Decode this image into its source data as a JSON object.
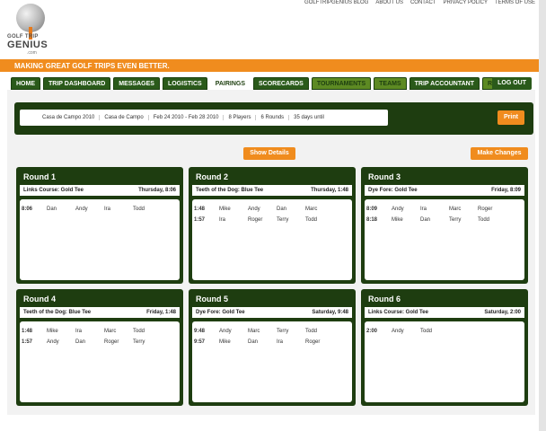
{
  "logo": {
    "line1": "GOLF TRIP",
    "line2": "GENIUS",
    "line3": ".com"
  },
  "top_links": [
    "GOLFTRIPGENIUS BLOG",
    "ABOUT US",
    "CONTACT",
    "PRIVACY POLICY",
    "TERMS OF USE"
  ],
  "banner": "MAKING GREAT GOLF TRIPS EVEN BETTER.",
  "nav": {
    "tabs": [
      {
        "label": "HOME",
        "style": "normal"
      },
      {
        "label": "TRIP DASHBOARD",
        "style": "normal"
      },
      {
        "label": "MESSAGES",
        "style": "normal"
      },
      {
        "label": "LOGISTICS",
        "style": "normal"
      },
      {
        "label": "PAIRINGS",
        "style": "active"
      },
      {
        "label": "SCORECARDS",
        "style": "normal"
      },
      {
        "label": "TOURNAMENTS",
        "style": "light"
      },
      {
        "label": "TEAMS",
        "style": "light"
      },
      {
        "label": "TRIP ACCOUNTANT",
        "style": "normal"
      },
      {
        "label": "REPORTS",
        "style": "light"
      }
    ],
    "logout": "LOG OUT"
  },
  "summary": {
    "items": [
      "Casa de Campo 2010",
      "Casa de Campo",
      "Feb 24 2010 - Feb 28 2010",
      "8 Players",
      "6 Rounds",
      "35 days until"
    ],
    "print": "Print"
  },
  "buttons": {
    "show_details": "Show Details",
    "make_changes": "Make Changes"
  },
  "rounds": [
    {
      "title": "Round 1",
      "course": "Links Course: Gold Tee",
      "when": "Thursday, 8:06",
      "groups": [
        {
          "time": "8:06",
          "players": [
            "Dan",
            "Andy",
            "Ira",
            "Todd"
          ]
        }
      ]
    },
    {
      "title": "Round 2",
      "course": "Teeth of the Dog: Blue Tee",
      "when": "Thursday, 1:48",
      "groups": [
        {
          "time": "1:48",
          "players": [
            "Mike",
            "Andy",
            "Dan",
            "Marc"
          ]
        },
        {
          "time": "1:57",
          "players": [
            "Ira",
            "Roger",
            "Terry",
            "Todd"
          ]
        }
      ]
    },
    {
      "title": "Round 3",
      "course": "Dye Fore: Gold Tee",
      "when": "Friday, 8:09",
      "groups": [
        {
          "time": "8:09",
          "players": [
            "Andy",
            "Ira",
            "Marc",
            "Roger"
          ]
        },
        {
          "time": "8:18",
          "players": [
            "Mike",
            "Dan",
            "Terry",
            "Todd"
          ]
        }
      ]
    },
    {
      "title": "Round 4",
      "course": "Teeth of the Dog: Blue Tee",
      "when": "Friday, 1:48",
      "groups": [
        {
          "time": "1:48",
          "players": [
            "Mike",
            "Ira",
            "Marc",
            "Todd"
          ]
        },
        {
          "time": "1:57",
          "players": [
            "Andy",
            "Dan",
            "Roger",
            "Terry"
          ]
        }
      ]
    },
    {
      "title": "Round 5",
      "course": "Dye Fore: Gold Tee",
      "when": "Saturday, 9:48",
      "groups": [
        {
          "time": "9:48",
          "players": [
            "Andy",
            "Marc",
            "Terry",
            "Todd"
          ]
        },
        {
          "time": "9:57",
          "players": [
            "Mike",
            "Dan",
            "Ira",
            "Roger"
          ]
        }
      ]
    },
    {
      "title": "Round 6",
      "course": "Links Course: Gold Tee",
      "when": "Saturday, 2:00",
      "groups": [
        {
          "time": "2:00",
          "players": [
            "Andy",
            "Todd"
          ]
        }
      ]
    }
  ],
  "colors": {
    "dark_green": "#1e3d10",
    "orange": "#f08c1e"
  }
}
